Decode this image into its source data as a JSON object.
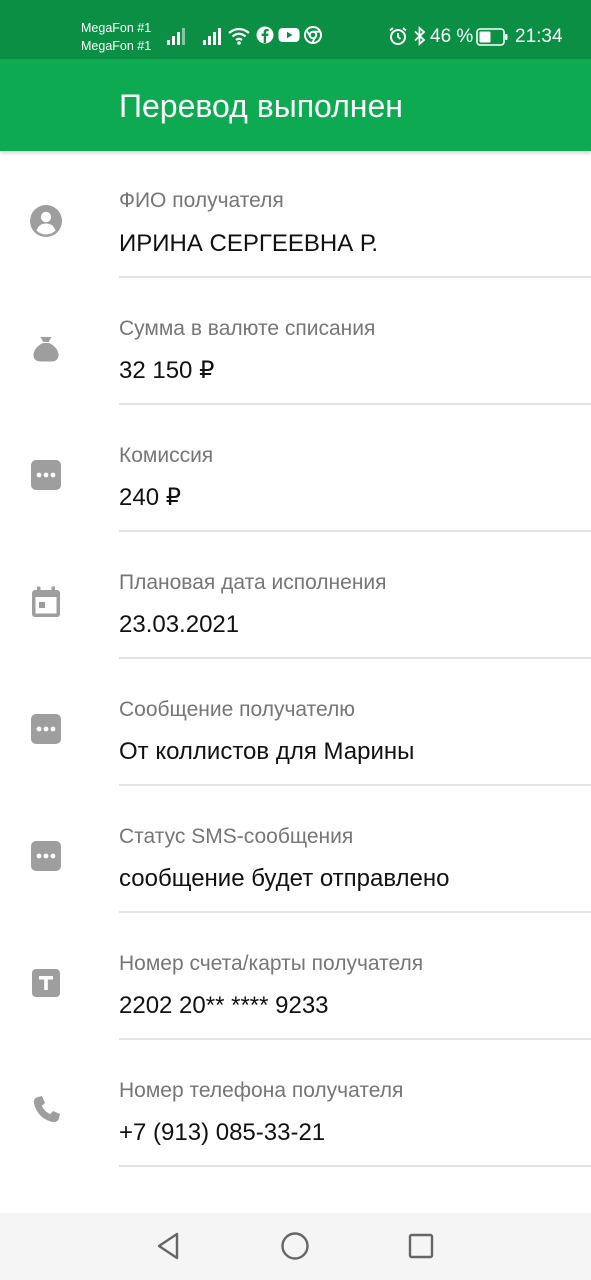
{
  "status_bar": {
    "operators": [
      "MegaFon #1",
      "MegaFon #1"
    ],
    "battery": "46 %",
    "time": "21:34",
    "icons": [
      "signal-icon",
      "signal-icon",
      "wifi-icon",
      "facebook-icon",
      "youtube-icon",
      "chrome-icon",
      "alarm-icon",
      "bluetooth-icon",
      "battery-icon"
    ]
  },
  "header": {
    "title": "Перевод выполнен"
  },
  "details": [
    {
      "label": "ФИО получателя",
      "value": "ИРИНА СЕРГЕЕВНА Р.",
      "icon": "person-icon"
    },
    {
      "label": "Сумма в валюте списания",
      "value": "32 150 ₽",
      "icon": "money-bag-icon"
    },
    {
      "label": "Комиссия",
      "value": "240 ₽",
      "icon": "dots-icon"
    },
    {
      "label": "Плановая дата исполнения",
      "value": "23.03.2021",
      "icon": "calendar-icon"
    },
    {
      "label": "Сообщение получателю",
      "value": "От коллистов для Марины",
      "icon": "dots-icon"
    },
    {
      "label": "Статус SMS-сообщения",
      "value": "сообщение будет отправлено",
      "icon": "dots-icon"
    },
    {
      "label": "Номер счета/карты получателя",
      "value": "2202 20** **** 9233",
      "icon": "card-t-icon"
    },
    {
      "label": "Номер телефона получателя",
      "value": "+7 (913) 085-33-21",
      "icon": "phone-icon"
    }
  ],
  "colors": {
    "status_bar": "#0a8f45",
    "app_bar": "#0daa52",
    "icon_grey": "#9e9e9e",
    "label_grey": "#767676"
  }
}
